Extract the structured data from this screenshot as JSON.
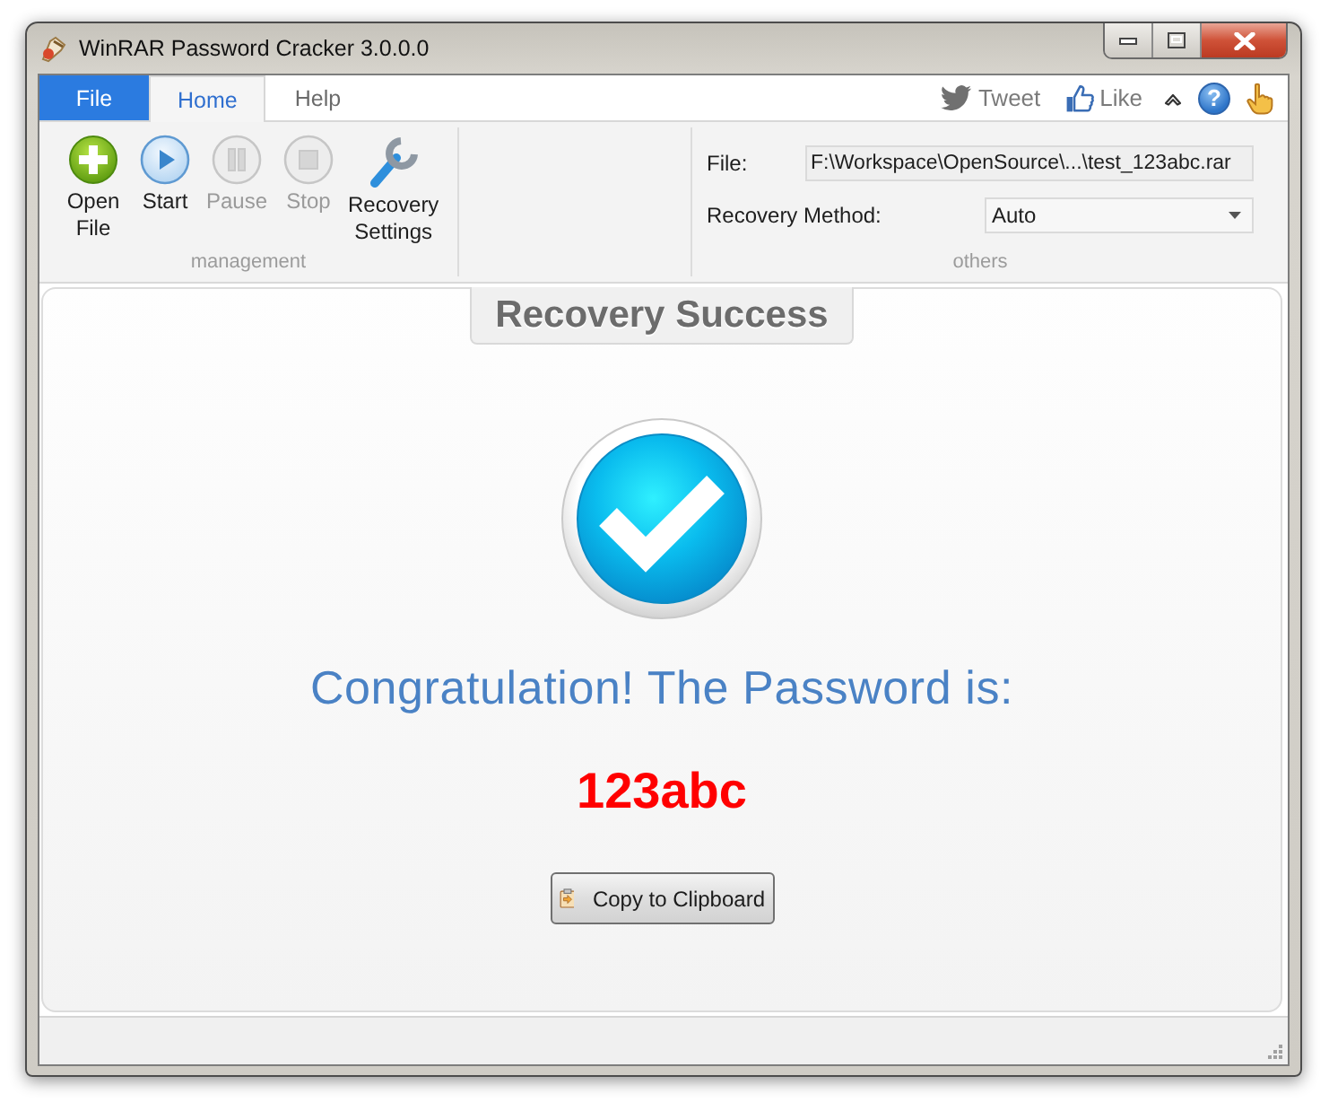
{
  "window": {
    "title": "WinRAR Password Cracker 3.0.0.0"
  },
  "ribbon_tabs": [
    {
      "label": "File",
      "kind": "menu",
      "selected": false
    },
    {
      "label": "Home",
      "kind": "tab",
      "selected": true
    },
    {
      "label": "Help",
      "kind": "tab",
      "selected": false
    }
  ],
  "ribbon_links": [
    {
      "label": "Tweet",
      "kind": "bird"
    },
    {
      "label": "Like",
      "kind": "thumb"
    }
  ],
  "help_button": {
    "label": "?"
  },
  "groups": [
    {
      "label": "management",
      "kind": "buttons",
      "buttons": [
        {
          "label": "Open File",
          "kind": "add",
          "disabled": false
        },
        {
          "label": "Start",
          "kind": "play",
          "disabled": false
        },
        {
          "label": "Pause",
          "kind": "pause",
          "disabled": true
        },
        {
          "label": "Stop",
          "kind": "stop",
          "disabled": true
        },
        {
          "label": "Recovery Settings",
          "kind": "wrench",
          "disabled": false
        }
      ]
    },
    {
      "label": "others",
      "kind": "fields",
      "fields": [
        {
          "label": "File:",
          "kind": "text",
          "value": "F:\\Workspace\\OpenSource\\...\\test_123abc.rar"
        },
        {
          "label": "Recovery Method:",
          "kind": "dropdown",
          "value": "Auto"
        }
      ]
    }
  ],
  "result": {
    "title": "Recovery Success",
    "message": "Congratulation! The Password is:",
    "password": "123abc",
    "copy_button": "Copy to Clipboard"
  }
}
